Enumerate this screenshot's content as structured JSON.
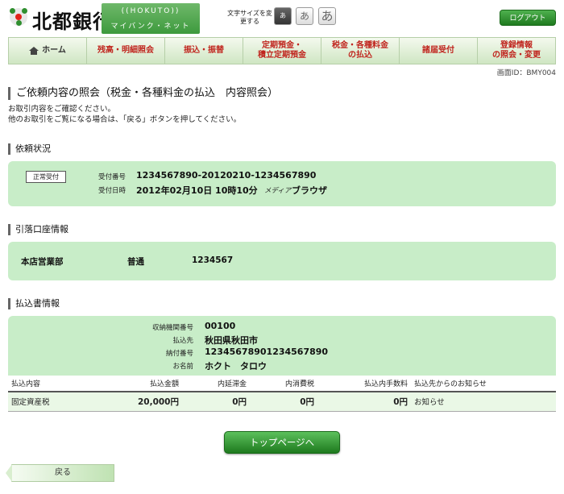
{
  "header": {
    "logo_text": "北都銀行",
    "logo_en": "((HOKUTO))",
    "logo_sub": "マイバンク・ネット",
    "fontsize_label": "文字サイズを変更する",
    "fontsize_small": "あ",
    "fontsize_medium": "あ",
    "fontsize_large": "あ",
    "logout": "ログアウト"
  },
  "nav": {
    "items": [
      {
        "label": "ホーム"
      },
      {
        "label": "残高・明細照会"
      },
      {
        "label": "振込・振替"
      },
      {
        "label": "定期預金・\n積立定期預金"
      },
      {
        "label": "税金・各種料金\nの払込"
      },
      {
        "label": "諸届受付"
      },
      {
        "label": "登録情報\nの照会・変更"
      }
    ]
  },
  "screen_id": "画面ID：BMY004",
  "page": {
    "title": "ご依頼内容の照会（税金・各種料金の払込　内容照会）",
    "intro_line1": "お取引内容をご確認ください。",
    "intro_line2": "他のお取引をご覧になる場合は、「戻る」ボタンを押してください。"
  },
  "request_status": {
    "section_title": "依頼状況",
    "badge": "正常受付",
    "receipt_no_label": "受付番号",
    "receipt_no": "1234567890-20120210-1234567890",
    "receipt_date_label": "受付日時",
    "receipt_date": "2012年02月10日 10時10分",
    "media_label": "メディア",
    "media": "ブラウザ"
  },
  "debit_account": {
    "section_title": "引落口座情報",
    "branch": "本店営業部",
    "type": "普通",
    "number": "1234567"
  },
  "payment_slip": {
    "section_title": "払込書情報",
    "org_no_label": "収納機関番号",
    "org_no": "00100",
    "payee_label": "払込先",
    "payee": "秋田県秋田市",
    "payment_no_label": "納付番号",
    "payment_no": "12345678901234567890",
    "name_label": "お名前",
    "name": "ホクト　タロウ"
  },
  "table": {
    "headers": [
      "払込内容",
      "払込金額",
      "内延滞金",
      "内消費税",
      "払込内手数料",
      "払込先からのお知らせ"
    ],
    "rows": [
      [
        "固定資産税",
        "20,000円",
        "0円",
        "0円",
        "0円",
        "お知らせ"
      ]
    ]
  },
  "buttons": {
    "top_page": "トップページへ",
    "back": "戻る"
  }
}
